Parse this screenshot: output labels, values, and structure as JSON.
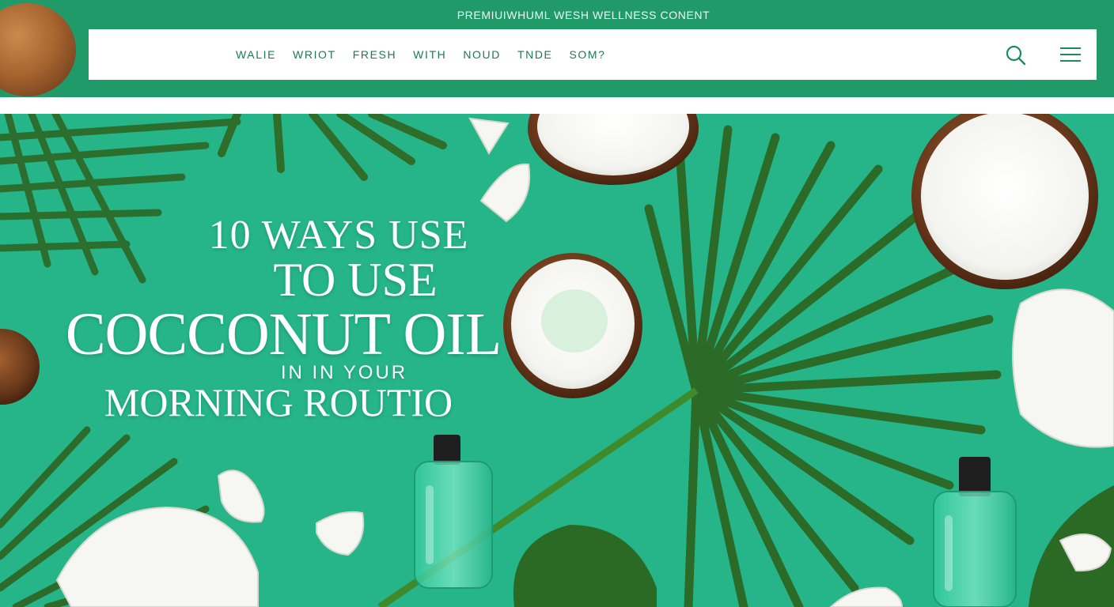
{
  "banner": {
    "tagline": "PREMIUIWHUML WESH WELLNESS CONENT"
  },
  "nav": {
    "links": [
      "WALIE",
      "WRIOT",
      "FRESH",
      "WITH",
      "NOUD",
      "TNDE",
      "SOM?"
    ],
    "search_icon": "search-icon",
    "menu_icon": "hamburger-menu-icon"
  },
  "hero": {
    "headline_line1": "10 WAYS USE",
    "headline_line2": "TO USE",
    "headline_line3": "COCCONUT OIL",
    "headline_line4": "IN IN YOUR",
    "headline_line5": "MORNING ROUTIO"
  },
  "colors": {
    "banner_green": "#219a6a",
    "hero_green": "#26b589",
    "leaf_green": "#2f6e2a",
    "coconut_brown": "#6b3a1c",
    "coconut_white": "#f7f7f4"
  }
}
